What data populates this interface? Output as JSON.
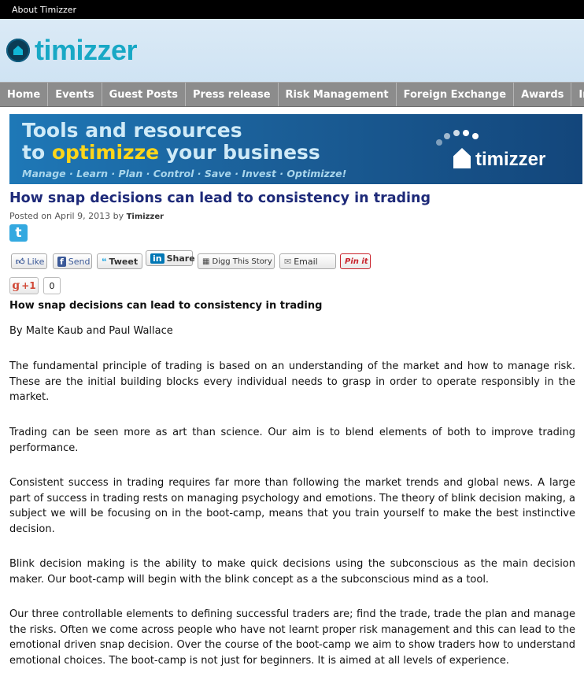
{
  "topbar": {
    "link": "About Timizzer"
  },
  "header": {
    "logo_text": "timizzer"
  },
  "nav": [
    "Home",
    "Events",
    "Guest Posts",
    "Press release",
    "Risk Management",
    "Foreign Exchange",
    "Awards",
    "Innovation"
  ],
  "banner": {
    "line1": "Tools and resources",
    "line2_pre": "to ",
    "line2_hl": "optimizze",
    "line2_post": " your business",
    "tagline": "Manage · Learn · Plan · Control · Save · Invest · Optimizze!",
    "logo_text": "timizzer"
  },
  "post": {
    "title": "How snap decisions can lead to consistency in trading",
    "posted_on": "Posted on April 9, 2013 by ",
    "author": "Timizzer",
    "subtitle": "How snap decisions can lead to consistency in trading",
    "byline": "By Malte Kaub and Paul Wallace",
    "paragraphs": [
      "The fundamental principle of trading is based on an understanding of the market and how to manage risk. These are the initial building blocks every individual needs to grasp in order to operate responsibly in the market.",
      "Trading can be seen more as art than science. Our aim is to blend elements of both to improve trading performance.",
      "Consistent success in trading requires far more than following the market trends and global news. A large part of success in trading rests on managing psychology and emotions. The theory of blink decision making, a subject we will be focusing on in the boot-camp, means that you train yourself to make the best instinctive decision.",
      "Blink decision making is the ability to make quick decisions using the subconscious as the main decision maker. Our boot-camp will begin with the blink concept as a the subconscious mind as a tool.",
      "Our three controllable elements to defining successful traders are; find the trade, trade the plan and manage the risks. Often we come across people who have not learnt proper risk management and this can lead to the emotional driven snap decision. Over the course of the boot-camp we aim to show traders how to understand emotional choices. The boot-camp is not just for beginners. It is aimed at all levels of experience."
    ]
  },
  "share": {
    "like": "Like",
    "send": "Send",
    "tweet": "Tweet",
    "linkedin_icon": "in",
    "share": "Share",
    "digg": "Digg This Story",
    "email": "Email",
    "pinit": "Pin it",
    "gplus": "+1",
    "gplus_count": "0"
  },
  "colors": {
    "title": "#1e2a79",
    "nav_bg": "#8c8c8c",
    "logo": "#18a8c5",
    "banner_highlight": "#ffd51a"
  }
}
